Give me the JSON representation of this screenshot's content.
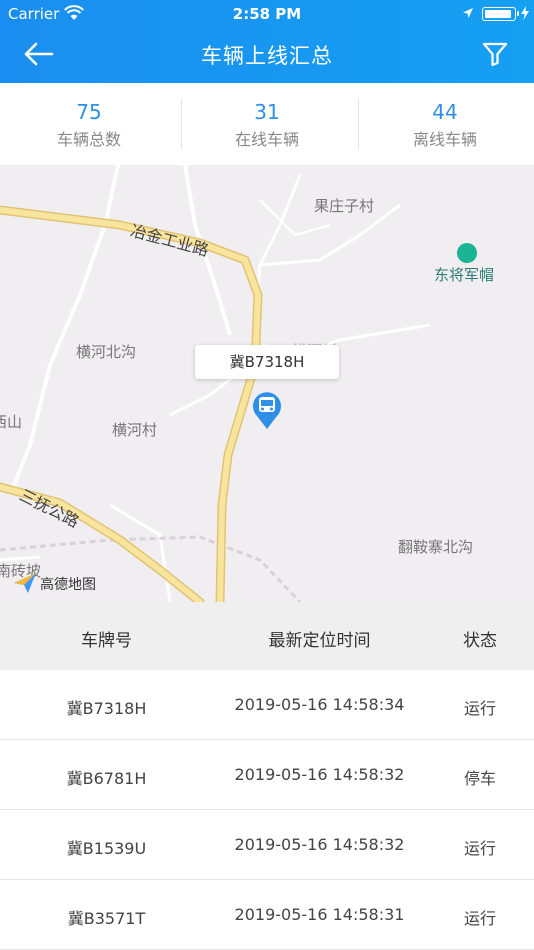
{
  "status_bar": {
    "carrier": "Carrier",
    "time": "2:58 PM"
  },
  "nav": {
    "title": "车辆上线汇总",
    "back_icon": "arrow-left-icon",
    "filter_icon": "filter-icon"
  },
  "stats": [
    {
      "value": "75",
      "label": "车辆总数"
    },
    {
      "value": "31",
      "label": "在线车辆"
    },
    {
      "value": "44",
      "label": "离线车辆"
    }
  ],
  "map": {
    "labels": {
      "guozhuangzi": "果庄子村",
      "yejin_road": "冶金工业路",
      "dongjiang": "东将军帽",
      "henghe_beigou": "横河北沟",
      "xishan": "西山",
      "henghe_cun": "横河村",
      "sanfu_road": "三抚公路",
      "fananzhai": "翻鞍寨北沟",
      "nanzhuanpo": "南砖坡",
      "partial_village": "横河村"
    },
    "callout": "冀B7318H",
    "marker_icon": "bus-marker-icon",
    "poi_icon": "campsite-icon",
    "logo_text": "高德地图"
  },
  "table": {
    "headers": [
      "车牌号",
      "最新定位时间",
      "状态"
    ],
    "rows": [
      {
        "plate": "冀B7318H",
        "time": "2019-05-16 14:58:34",
        "status": "运行"
      },
      {
        "plate": "冀B6781H",
        "time": "2019-05-16 14:58:32",
        "status": "停车"
      },
      {
        "plate": "冀B1539U",
        "time": "2019-05-16 14:58:32",
        "status": "运行"
      },
      {
        "plate": "冀B3571T",
        "time": "2019-05-16 14:58:31",
        "status": "运行"
      }
    ]
  },
  "colors": {
    "header": "#1a8ef0",
    "stat_number": "#2f8fe6",
    "marker": "#2f8fe6",
    "poi": "#1ab394"
  }
}
